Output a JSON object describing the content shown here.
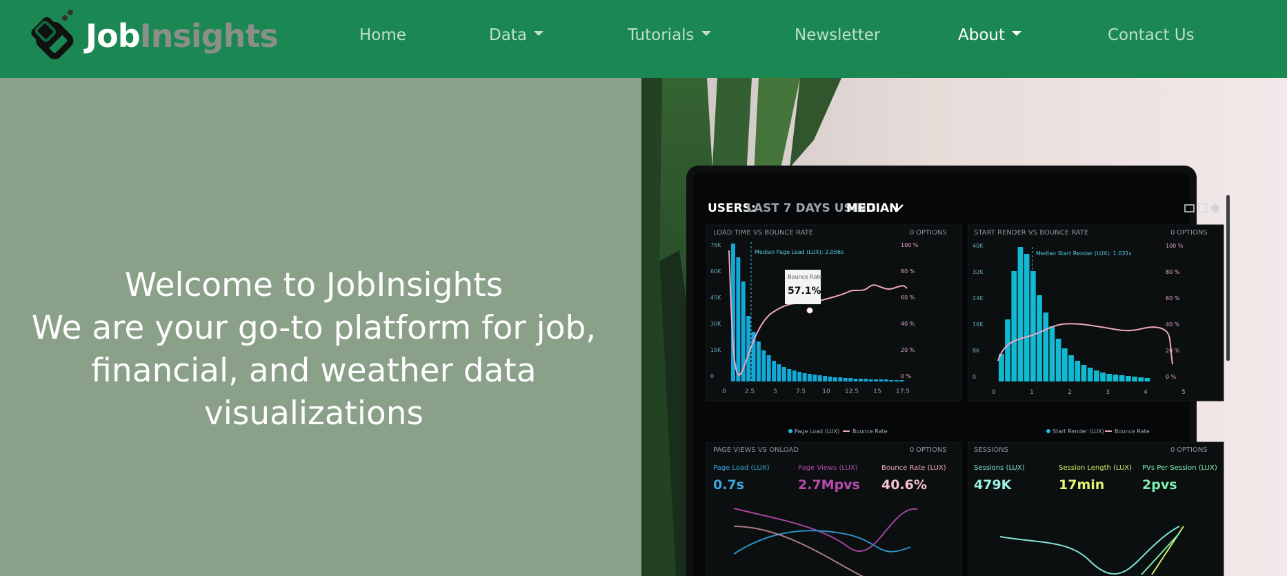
{
  "brand": {
    "part1": "Job",
    "part2": "Insights",
    "logo_icon": "jobinsights-logo-icon"
  },
  "nav": {
    "home": "Home",
    "data": "Data",
    "tutorials": "Tutorials",
    "newsletter": "Newsletter",
    "about": "About",
    "contact": "Contact Us"
  },
  "hero": {
    "line1": "Welcome to JobInsights",
    "line2": "We are your go-to platform for job,",
    "line3": "financial, and weather data",
    "line4": "visualizations"
  },
  "colors": {
    "navbar": "#1b8752",
    "hero_left": "#8aa088",
    "nav_text": "#bfe0c9",
    "nav_active": "#ffffff"
  },
  "laptop": {
    "header_users": "USERS:",
    "header_rest": "LAST 7 DAYS USING",
    "header_median": "MEDIAN",
    "panel1_title": "LOAD TIME VS BOUNCE RATE",
    "panel2_title": "START RENDER VS BOUNCE RATE",
    "panel3_title": "PAGE VIEWS VS ONLOAD",
    "panel4_title": "SESSIONS",
    "options": "OPTIONS",
    "median_page_load": "Median Page Load (LUX): 2.056s",
    "median_start_render": "Median Start Render (LUX): 1.031s",
    "tooltip_label": "Bounce Rate",
    "tooltip_value": "57.1%",
    "legend1a": "Page Load (LUX)",
    "legend1b": "Bounce Rate",
    "legend2a": "Start Render (LUX)",
    "legend2b": "Bounce Rate",
    "stat1_label": "Page Load (LUX)",
    "stat1_value": "0.7s",
    "stat2_label": "Page Views (LUX)",
    "stat2_value": "2.7Mpvs",
    "stat3_label": "Bounce Rate (LUX)",
    "stat3_value": "40.6%",
    "stat4_label": "Sessions (LUX)",
    "stat4_value": "479K",
    "stat5_label": "Session Length (LUX)",
    "stat5_value": "17min",
    "stat6_label": "PVs Per Session (LUX)",
    "stat6_value": "2pvs",
    "y1": [
      "75K",
      "60K",
      "45K",
      "30K",
      "15K",
      "0"
    ],
    "y1r": [
      "100 %",
      "80 %",
      "60 %",
      "40 %",
      "20 %",
      "0 %"
    ],
    "x1": [
      "0",
      "2.5",
      "5",
      "7.5",
      "10",
      "12.5",
      "15",
      "17.5"
    ],
    "y2": [
      "40K",
      "32K",
      "24K",
      "16K",
      "8K",
      "0"
    ],
    "y2r": [
      "100 %",
      "80 %",
      "60 %",
      "40 %",
      "20 %",
      "0 %"
    ],
    "x2": [
      "0",
      "1",
      "2",
      "3",
      "4",
      "5"
    ]
  }
}
